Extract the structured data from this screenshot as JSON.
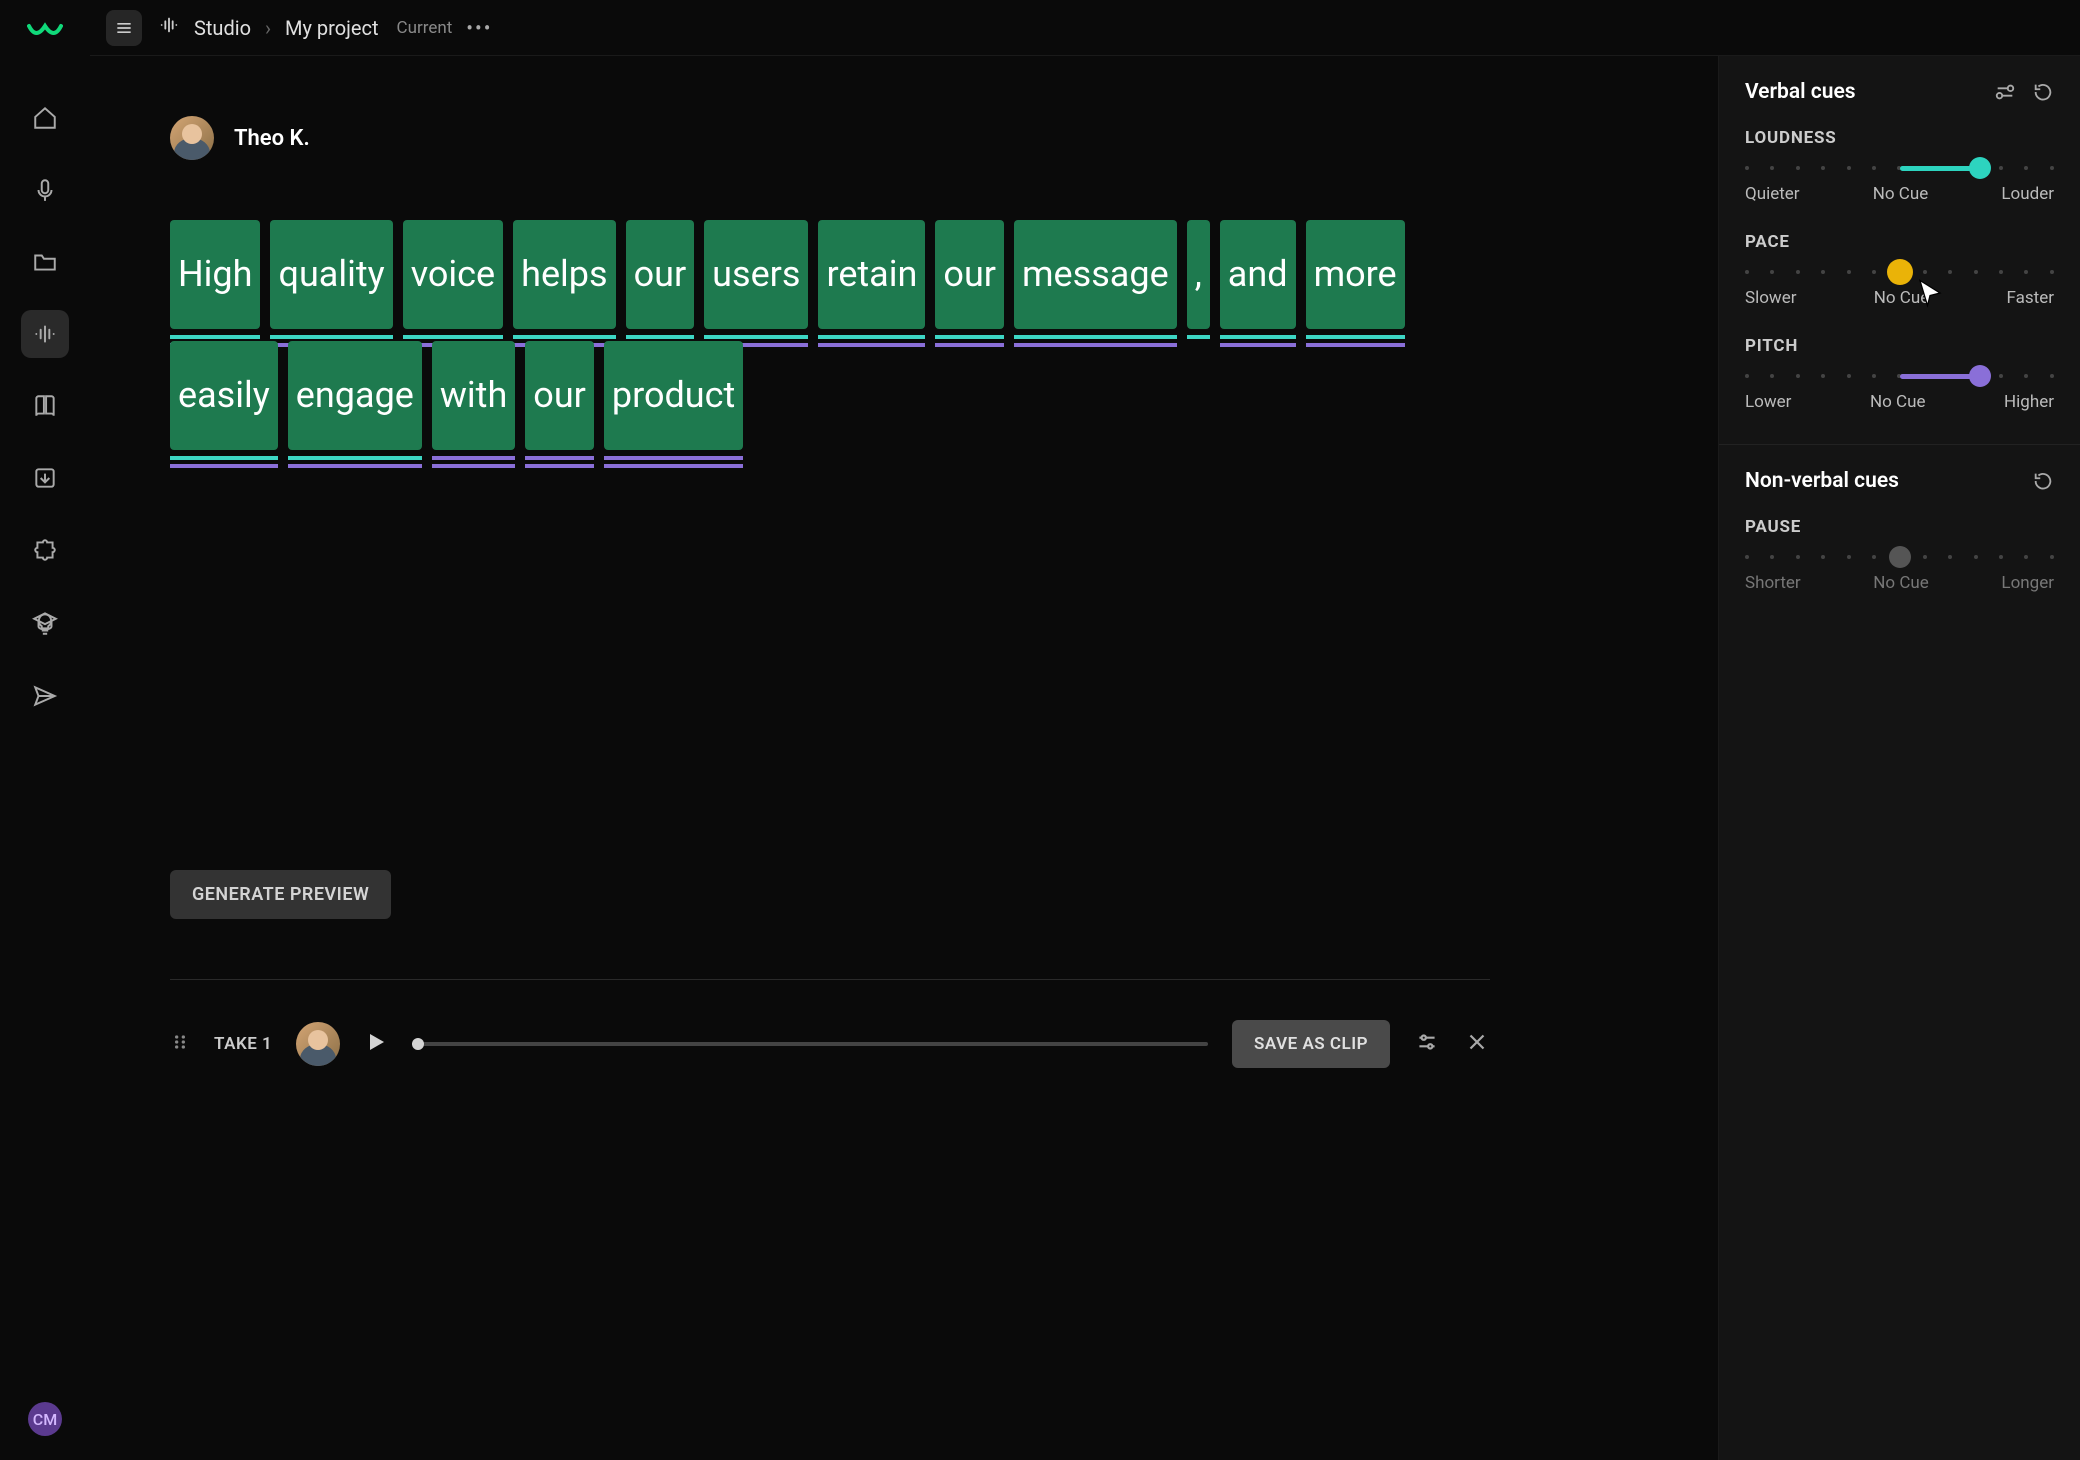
{
  "header": {
    "studio_label": "Studio",
    "project_label": "My project",
    "project_badge": "Current"
  },
  "speaker": {
    "name": "Theo K."
  },
  "words": [
    {
      "text": "High",
      "style": "double"
    },
    {
      "text": "quality",
      "style": "double"
    },
    {
      "text": "voice",
      "style": "double"
    },
    {
      "text": "helps",
      "style": "double"
    },
    {
      "text": "our",
      "style": "double"
    },
    {
      "text": "users",
      "style": "double"
    },
    {
      "text": "retain",
      "style": "double"
    },
    {
      "text": "our",
      "style": "double"
    },
    {
      "text": "message",
      "style": "double"
    },
    {
      "text": ",",
      "style": "single"
    },
    {
      "text": "and",
      "style": "double"
    },
    {
      "text": "more",
      "style": "double"
    },
    {
      "text": "easily",
      "style": "double"
    },
    {
      "text": "engage",
      "style": "double"
    },
    {
      "text": "with",
      "style": "purple"
    },
    {
      "text": "our",
      "style": "purple"
    },
    {
      "text": "product",
      "style": "purple"
    }
  ],
  "buttons": {
    "generate": "GENERATE PREVIEW",
    "save_clip": "SAVE AS CLIP"
  },
  "take": {
    "label": "TAKE 1"
  },
  "verbal_panel": {
    "title": "Verbal cues",
    "loudness": {
      "label": "LOUDNESS",
      "left": "Quieter",
      "mid": "No Cue",
      "right": "Louder",
      "color": "#2dd4bf",
      "value": 76
    },
    "pace": {
      "label": "PACE",
      "left": "Slower",
      "mid": "No Cue",
      "right": "Faster",
      "color": "#eab308",
      "value": 50
    },
    "pitch": {
      "label": "PITCH",
      "left": "Lower",
      "mid": "No Cue",
      "right": "Higher",
      "color": "#8a6fd8",
      "value": 76
    }
  },
  "nonverbal_panel": {
    "title": "Non-verbal cues",
    "pause": {
      "label": "PAUSE",
      "left": "Shorter",
      "mid": "No Cue",
      "right": "Longer",
      "color": "#555",
      "value": 50
    }
  },
  "user_initials": "CM"
}
